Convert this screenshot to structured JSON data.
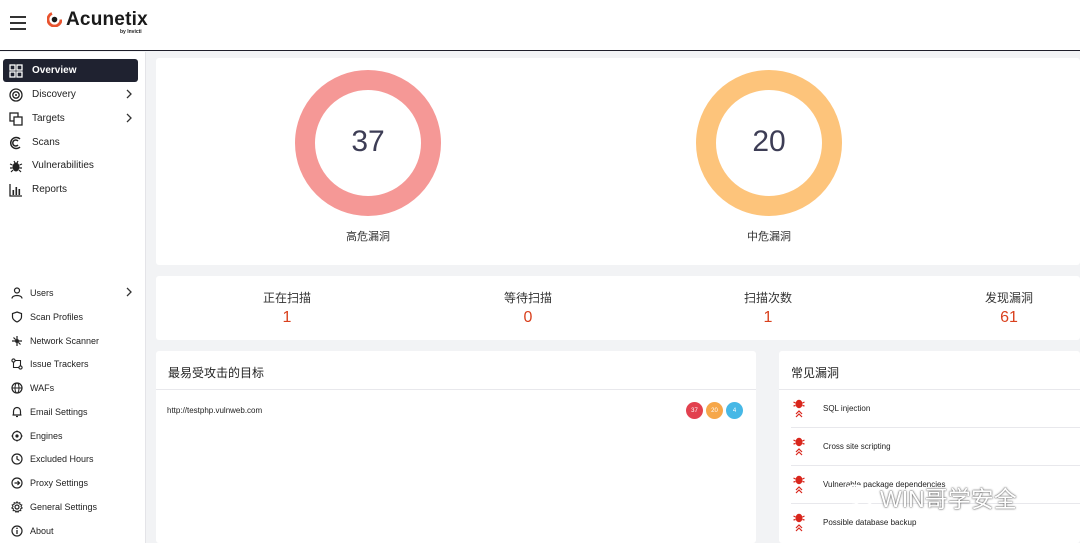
{
  "app": {
    "brand": "Acunetix",
    "brand_sub": "by Invicti"
  },
  "sidebar": {
    "primary": [
      {
        "label": "Overview",
        "icon": "grid-icon",
        "active": true
      },
      {
        "label": "Discovery",
        "icon": "target-icon",
        "chevron": true
      },
      {
        "label": "Targets",
        "icon": "targets-icon",
        "chevron": true
      },
      {
        "label": "Scans",
        "icon": "scan-icon"
      },
      {
        "label": "Vulnerabilities",
        "icon": "bug-icon"
      },
      {
        "label": "Reports",
        "icon": "bar-chart-icon"
      }
    ],
    "secondary": [
      {
        "label": "Users",
        "icon": "user-icon",
        "chevron": true
      },
      {
        "label": "Scan Profiles",
        "icon": "shield-icon"
      },
      {
        "label": "Network Scanner",
        "icon": "network-icon"
      },
      {
        "label": "Issue Trackers",
        "icon": "tracker-icon"
      },
      {
        "label": "WAFs",
        "icon": "globe-icon"
      },
      {
        "label": "Email Settings",
        "icon": "bell-icon"
      },
      {
        "label": "Engines",
        "icon": "engine-icon"
      },
      {
        "label": "Excluded Hours",
        "icon": "clock-icon"
      },
      {
        "label": "Proxy Settings",
        "icon": "proxy-icon"
      },
      {
        "label": "General Settings",
        "icon": "gear-icon"
      },
      {
        "label": "About",
        "icon": "info-icon"
      }
    ]
  },
  "overview": {
    "high": {
      "value": "37",
      "label": "高危漏洞",
      "color": "#f59896"
    },
    "medium": {
      "value": "20",
      "label": "中危漏洞",
      "color": "#fdc47b"
    }
  },
  "stats": [
    {
      "label": "正在扫描",
      "value": "1"
    },
    {
      "label": "等待扫描",
      "value": "0"
    },
    {
      "label": "扫描次数",
      "value": "1"
    },
    {
      "label": "发现漏洞",
      "value": "61"
    }
  ],
  "targets": {
    "title": "最易受攻击的目标",
    "rows": [
      {
        "url": "http://testphp.vulnweb.com",
        "high": "37",
        "medium": "20",
        "low": "4"
      }
    ],
    "badge_colors": {
      "high": "#e2414f",
      "medium": "#f6a749",
      "low": "#46b8e6"
    }
  },
  "vulns": {
    "title": "常见漏洞",
    "rows": [
      {
        "name": "SQL injection"
      },
      {
        "name": "Cross site scripting"
      },
      {
        "name": "Vulnerable package dependencies"
      },
      {
        "name": "Possible database backup"
      }
    ]
  },
  "watermark": "WIN哥学安全",
  "accent_color": "#d9411e"
}
